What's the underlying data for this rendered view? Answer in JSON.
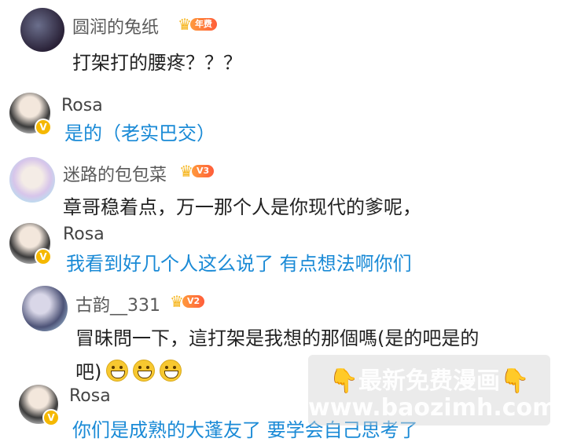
{
  "comments": [
    {
      "user": "圆润的兔纸",
      "level": "年费",
      "text": "打架打的腰疼？？？"
    },
    {
      "user": "Rosa",
      "text": "是的（老实巴交）"
    },
    {
      "user": "迷路的包包菜",
      "level": "V3",
      "text": "章哥稳着点，万一那个人是你现代的爹呢，"
    },
    {
      "user": "Rosa",
      "text": "我看到好几个人这么说了 有点想法啊你们"
    },
    {
      "user": "古韵__331",
      "level": "V2",
      "text_line1": "冒昧問一下，這打架是我想的那個嗎(是的吧是的",
      "text_line2": "吧)"
    },
    {
      "user": "Rosa",
      "text": "你们是成熟的大蓬友了 要学会自己思考了"
    }
  ],
  "watermark": {
    "line1": "最新免费漫画",
    "line2": "www.baozimh.com"
  },
  "colors": {
    "reply_blue": "#1a8ad6",
    "crown": "#f6b51c",
    "vip": "#f5b800"
  }
}
